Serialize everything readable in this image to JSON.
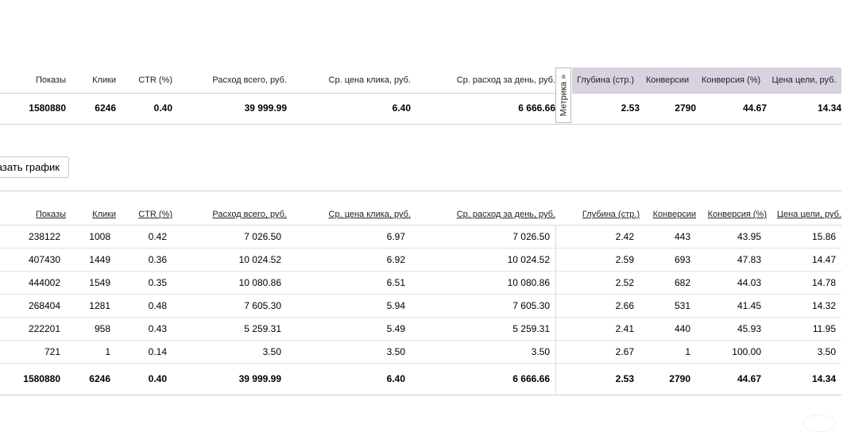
{
  "columns": [
    "Показы",
    "Клики",
    "CTR (%)",
    "Расход всего, руб.",
    "Ср. цена клика, руб.",
    "Ср. расход за день, руб.",
    "Глубина (стр.)",
    "Конверсии",
    "Конверсия (%)",
    "Цена цели, руб."
  ],
  "metrika_tab_label": "Метрика »",
  "summary": {
    "values": [
      "1580880",
      "6246",
      "0.40",
      "39 999.99",
      "6.40",
      "6 666.66",
      "2.53",
      "2790",
      "44.67",
      "14.34"
    ]
  },
  "chart_button": {
    "label": "азать график"
  },
  "table": {
    "rows": [
      [
        "238122",
        "1008",
        "0.42",
        "7 026.50",
        "6.97",
        "7 026.50",
        "2.42",
        "443",
        "43.95",
        "15.86"
      ],
      [
        "407430",
        "1449",
        "0.36",
        "10 024.52",
        "6.92",
        "10 024.52",
        "2.59",
        "693",
        "47.83",
        "14.47"
      ],
      [
        "444002",
        "1549",
        "0.35",
        "10 080.86",
        "6.51",
        "10 080.86",
        "2.52",
        "682",
        "44.03",
        "14.78"
      ],
      [
        "268404",
        "1281",
        "0.48",
        "7 605.30",
        "5.94",
        "7 605.30",
        "2.66",
        "531",
        "41.45",
        "14.32"
      ],
      [
        "222201",
        "958",
        "0.43",
        "5 259.31",
        "5.49",
        "5 259.31",
        "2.41",
        "440",
        "45.93",
        "11.95"
      ],
      [
        "721",
        "1",
        "0.14",
        "3.50",
        "3.50",
        "3.50",
        "2.67",
        "1",
        "100.00",
        "3.50"
      ]
    ],
    "total": [
      "1580880",
      "6246",
      "0.40",
      "39 999.99",
      "6.40",
      "6 666.66",
      "2.53",
      "2790",
      "44.67",
      "14.34"
    ]
  }
}
